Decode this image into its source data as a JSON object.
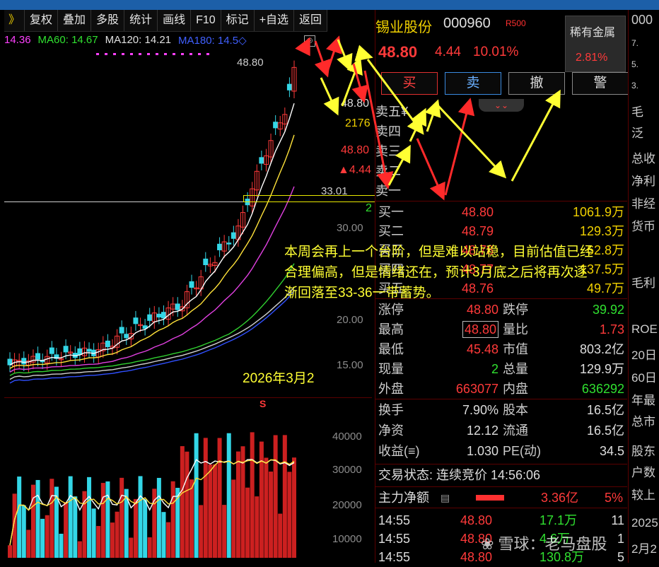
{
  "toolbar": {
    "arrow": "》",
    "items": [
      "复权",
      "叠加",
      "多股",
      "统计",
      "画线",
      "F10",
      "标记",
      "+自选",
      "返回"
    ]
  },
  "ma_legend": {
    "ma_a": "14.36",
    "ma60": "MA60: 14.67",
    "ma120": "MA120: 14.21",
    "ma180": "MA180: 14.5◇"
  },
  "kline": {
    "high_label": "48.80",
    "level_label": "33.01",
    "price_ticks": [
      "30.00",
      "20.00",
      "15.00"
    ],
    "vol_ticks": [
      "40000",
      "30000",
      "20000",
      "10000"
    ],
    "mid_labels": {
      "price1": "48.80",
      "vol": "2176",
      "price2": "48.80",
      "chg": "▲4.44",
      "two": "2"
    }
  },
  "annotation": {
    "line1": "本周会再上一个台阶，但是难以站稳，目前估值已经",
    "line2": "合理偏高，但是情绪还在，预计3月底之后将再次逐",
    "line3": "渐回落至33-36一带蓄势。"
  },
  "date_label": "2026年3月2",
  "stock": {
    "name": "锡业股份",
    "code": "000960",
    "r_badge": "R500",
    "price": "48.80",
    "change": "4.44",
    "pct": "10.01%",
    "sector_name": "稀有金属",
    "sector_pct": "2.81%"
  },
  "buttons": {
    "buy": "买",
    "sell": "卖",
    "cancel": "撤",
    "alert": "警"
  },
  "asks": [
    "卖五¥",
    "卖四",
    "卖三",
    "卖二",
    "卖一"
  ],
  "bids": [
    {
      "label": "买一",
      "price": "48.80",
      "vol": "1061.9万"
    },
    {
      "label": "买二",
      "price": "48.79",
      "vol": "129.3万"
    },
    {
      "label": "买三",
      "price": "48.78",
      "vol": "62.8万"
    },
    {
      "label": "买四",
      "price": "48.77",
      "vol": "137.5万"
    },
    {
      "label": "买五",
      "price": "48.76",
      "vol": "49.7万"
    }
  ],
  "stats": [
    {
      "l1": "涨停",
      "v1": "48.80",
      "l2": "跌停",
      "v2": "39.92"
    },
    {
      "l1": "最高",
      "v1": "48.80",
      "l2": "量比",
      "v2": "1.73"
    },
    {
      "l1": "最低",
      "v1": "45.48",
      "l2": "市值",
      "v2": "803.2亿"
    },
    {
      "l1": "现量",
      "v1": "2",
      "l2": "总量",
      "v2": "129.9万"
    },
    {
      "l1": "外盘",
      "v1": "663077",
      "l2": "内盘",
      "v2": "636292"
    }
  ],
  "stats2": [
    {
      "l1": "换手",
      "v1": "7.90%",
      "l2": "股本",
      "v2": "16.5亿"
    },
    {
      "l1": "净资",
      "v1": "12.12",
      "l2": "流通",
      "v2": "16.5亿"
    },
    {
      "l1": "收益(≡)",
      "v1": "1.030",
      "l2": "PE(动)",
      "v2": "34.5"
    }
  ],
  "trade_status": "交易状态: 连续竞价 14:56:06",
  "main_flow": {
    "label": "主力净额",
    "value": "3.36亿",
    "pct": "5%"
  },
  "ticks": [
    {
      "t": "14:55",
      "p": "48.80",
      "v": "17.1万",
      "n": "11"
    },
    {
      "t": "14:55",
      "p": "48.80",
      "v": "4.6万",
      "n": "1"
    },
    {
      "t": "14:55",
      "p": "48.80",
      "v": "130.8万",
      "n": "5"
    }
  ],
  "far_right": [
    "000",
    "7.",
    "5.",
    "3.",
    "毛",
    "泛",
    "总收",
    "净利",
    "非经",
    "货币",
    "毛利",
    "ROE",
    "20日",
    "60日",
    "年最",
    "总市",
    "股东",
    "户数",
    "较上",
    "2025",
    "2月2"
  ],
  "watermark": "❀ 雪球：老马盘股",
  "colors": {
    "up": "#ff3a3a",
    "down": "#33d6e6",
    "yellow": "#ffff33"
  }
}
